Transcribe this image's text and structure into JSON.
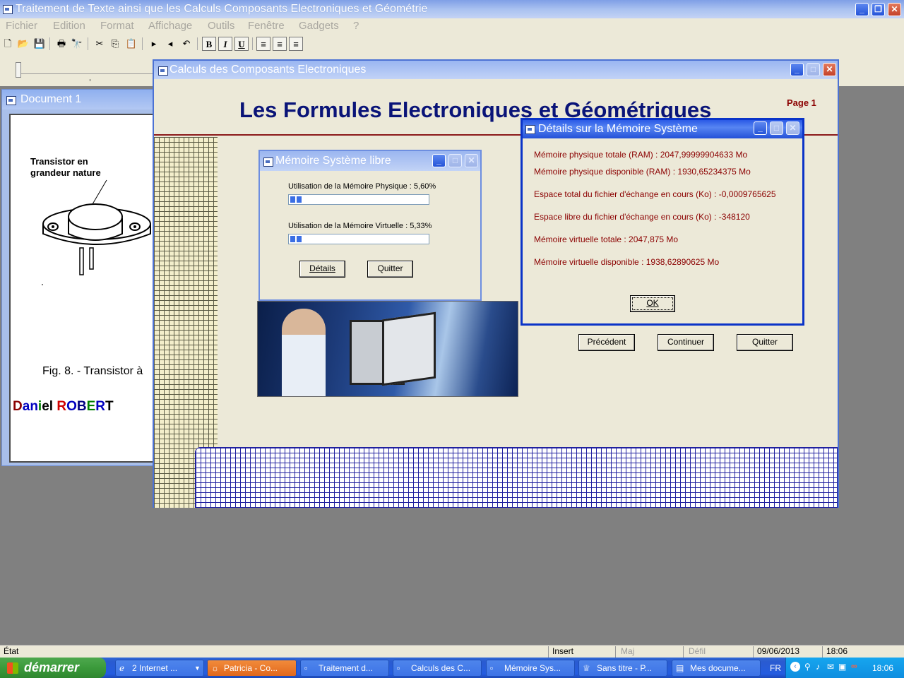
{
  "app": {
    "title": "Traitement de Texte ainsi que les Calculs Composants Electroniques et Géométrie",
    "menu": [
      "Fichier",
      "Edition",
      "Format",
      "Affichage",
      "Outils",
      "Fenêtre",
      "Gadgets",
      "?"
    ]
  },
  "toolbar": {
    "bold": "B",
    "italic": "I",
    "underline": "U"
  },
  "document": {
    "title": "Document 1",
    "caption_top": "Transistor en",
    "caption_top2": "grandeur nature",
    "figure_caption": "Fig. 8. - Transistor à",
    "author_first": [
      "D",
      "a",
      "n",
      "i",
      "e",
      "l"
    ],
    "author_last": [
      "R",
      "O",
      "B",
      "E",
      "R",
      "T"
    ]
  },
  "calc_window": {
    "title": "Calculs des Composants Electroniques",
    "heading": "Les Formules Electroniques et Géométriques",
    "page_label": "Page 1",
    "btn_prev": "Précédent",
    "btn_continue": "Continuer",
    "btn_quit": "Quitter"
  },
  "memory_window": {
    "title": "Mémoire Système libre",
    "physical_label": "Utilisation de la Mémoire Physique : 5,60%",
    "physical_pct": 5.6,
    "virtual_label": "Utilisation de la Mémoire Virtuelle : 5,33%",
    "virtual_pct": 5.33,
    "btn_details": "Détails",
    "btn_quit": "Quitter"
  },
  "details_window": {
    "title": "Détails sur la Mémoire Système",
    "lines": [
      "Mémoire physique totale (RAM) : 2047,99999904633 Mo",
      "Mémoire physique disponible (RAM) : 1930,65234375 Mo",
      "Espace total du fichier d'échange en cours (Ko) : -0,0009765625",
      "Espace libre du fichier d'échange en cours (Ko) : -348120",
      "Mémoire virtuelle totale : 2047,875 Mo",
      "Mémoire virtuelle disponible : 1938,62890625 Mo"
    ],
    "btn_ok": "OK"
  },
  "statusbar": {
    "state": "État",
    "insert": "Insert",
    "maj": "Maj",
    "defil": "Défil",
    "date": "09/06/2013",
    "time": "18:06"
  },
  "taskbar": {
    "start": "démarrer",
    "tasks": [
      "2 Internet ...",
      "Patricia - Co...",
      "Traitement d...",
      "Calculs des C...",
      "Mémoire Sys...",
      "Sans titre - P...",
      "Mes docume..."
    ],
    "lang": "FR",
    "clock": "18:06"
  },
  "colors": {
    "heading": "#0a1478",
    "details_text": "#8b0000",
    "author_colors": [
      "#8b0000",
      "#000",
      "#000",
      "#0000c0",
      "#0000c0",
      "#008000"
    ]
  }
}
